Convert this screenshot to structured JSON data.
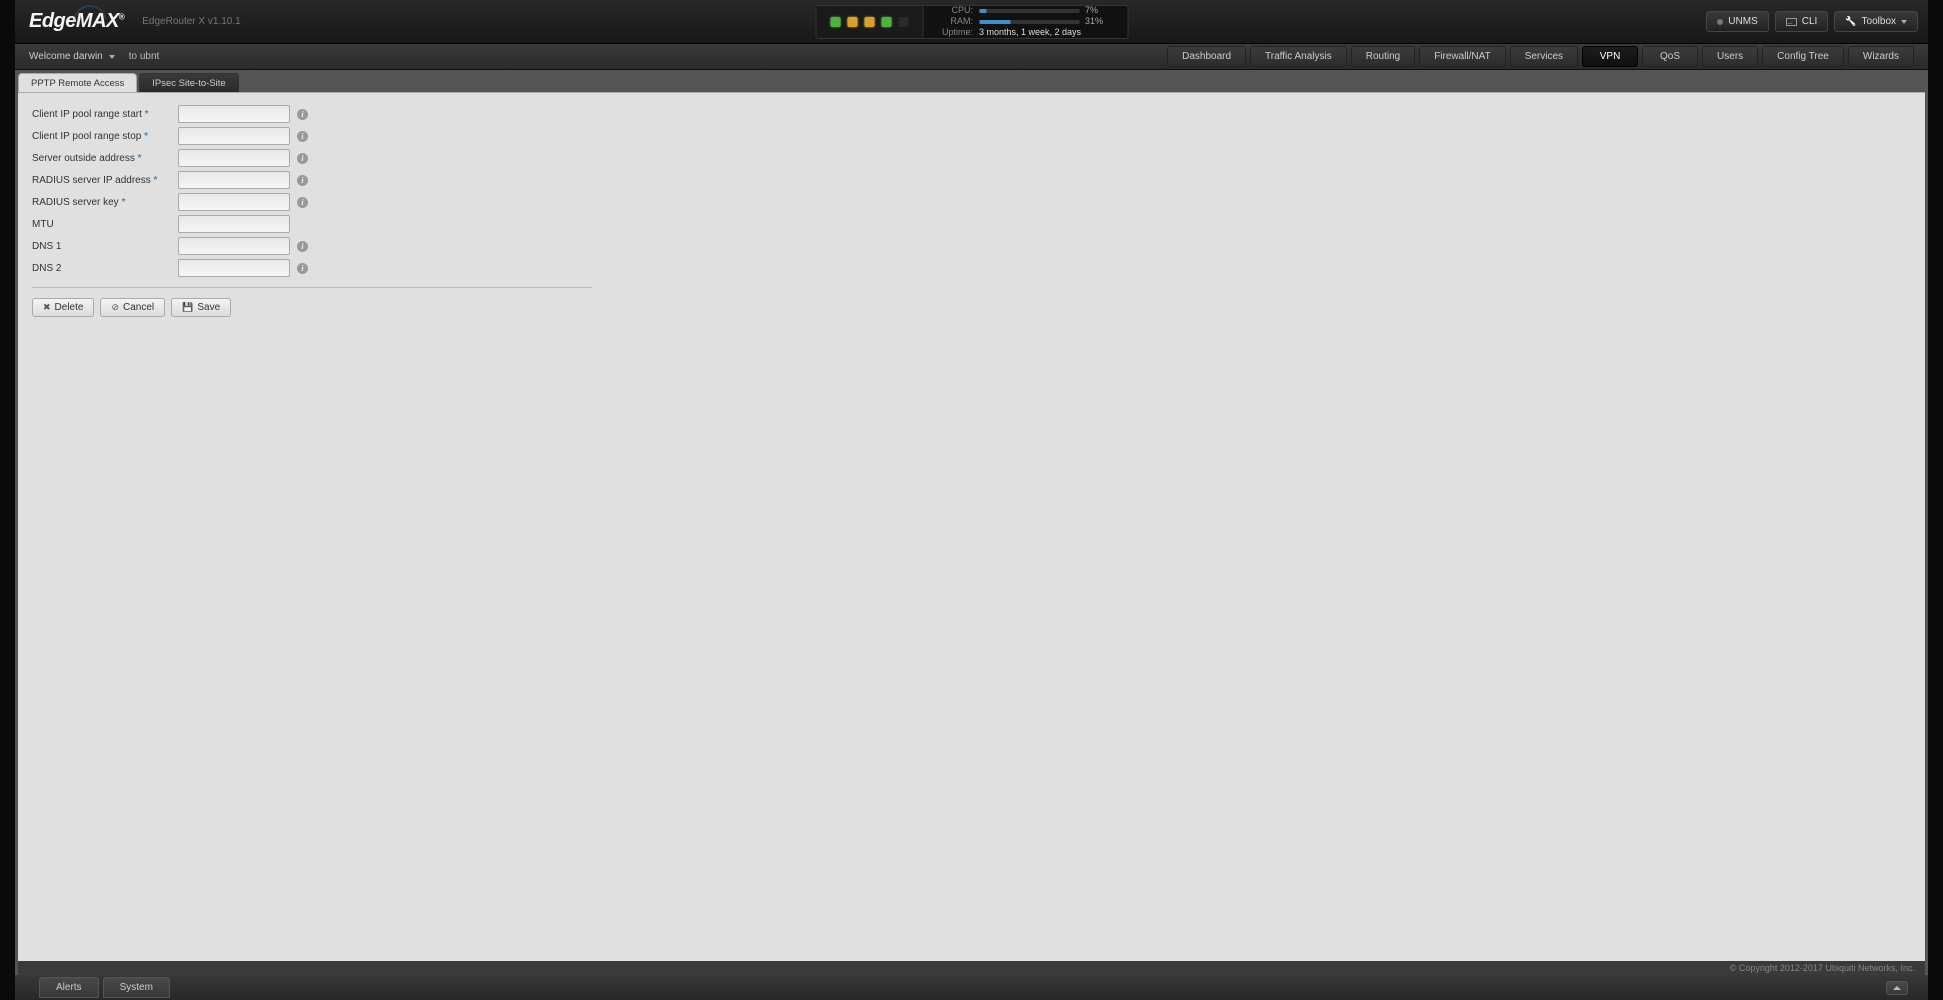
{
  "header": {
    "logo_main": "Edge",
    "logo_sub": "MAX",
    "model": "EdgeRouter X v1.10.1",
    "cpu_label": "CPU:",
    "ram_label": "RAM:",
    "uptime_label": "Uptime:",
    "cpu_pct": "7%",
    "ram_pct": "31%",
    "cpu_fill": 7,
    "ram_fill": 31,
    "uptime": "3 months, 1 week, 2 days",
    "unms_label": "UNMS",
    "cli_label": "CLI",
    "toolbox_label": "Toolbox"
  },
  "secondbar": {
    "welcome": "Welcome darwin",
    "breadcrumb": "to ubnt"
  },
  "nav": [
    {
      "label": "Dashboard"
    },
    {
      "label": "Traffic Analysis"
    },
    {
      "label": "Routing"
    },
    {
      "label": "Firewall/NAT"
    },
    {
      "label": "Services"
    },
    {
      "label": "VPN",
      "active": true
    },
    {
      "label": "QoS"
    },
    {
      "label": "Users"
    },
    {
      "label": "Config Tree"
    },
    {
      "label": "Wizards"
    }
  ],
  "subtabs": [
    {
      "label": "PPTP Remote Access",
      "active": true
    },
    {
      "label": "IPsec Site-to-Site"
    }
  ],
  "form": {
    "fields": [
      {
        "label": "Client IP pool range start",
        "required": true,
        "info": true,
        "value": ""
      },
      {
        "label": "Client IP pool range stop",
        "required": true,
        "info": true,
        "value": ""
      },
      {
        "label": "Server outside address",
        "required": true,
        "info": true,
        "value": ""
      },
      {
        "label": "RADIUS server IP address",
        "required": true,
        "info": true,
        "value": ""
      },
      {
        "label": "RADIUS server key",
        "required": true,
        "info": true,
        "value": ""
      },
      {
        "label": "MTU",
        "required": false,
        "info": false,
        "value": ""
      },
      {
        "label": "DNS 1",
        "required": false,
        "info": true,
        "value": ""
      },
      {
        "label": "DNS 2",
        "required": false,
        "info": true,
        "value": ""
      }
    ]
  },
  "actions": {
    "delete": "Delete",
    "cancel": "Cancel",
    "save": "Save"
  },
  "footer": {
    "copyright": "© Copyright 2012-2017 Ubiquiti Networks, Inc."
  },
  "bottom": {
    "alerts": "Alerts",
    "system": "System"
  }
}
